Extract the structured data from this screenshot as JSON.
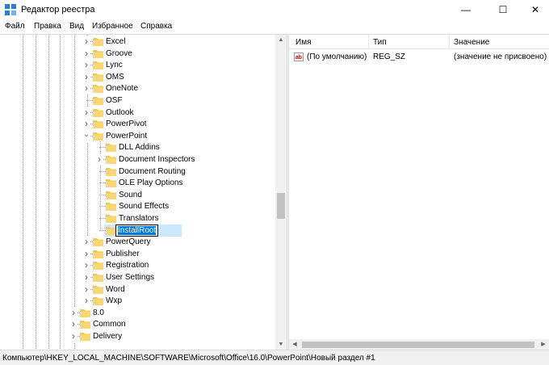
{
  "window": {
    "title": "Редактор реестра",
    "minimize_glyph": "—",
    "maximize_glyph": "☐",
    "close_glyph": "✕"
  },
  "menu": [
    "Файл",
    "Правка",
    "Вид",
    "Избранное",
    "Справка"
  ],
  "tree": {
    "items": [
      {
        "label": "Excel",
        "level": 2,
        "expander": "collapsed"
      },
      {
        "label": "Groove",
        "level": 2,
        "expander": "collapsed"
      },
      {
        "label": "Lync",
        "level": 2,
        "expander": "collapsed"
      },
      {
        "label": "OMS",
        "level": 2,
        "expander": "collapsed"
      },
      {
        "label": "OneNote",
        "level": 2,
        "expander": "collapsed"
      },
      {
        "label": "OSF",
        "level": 2,
        "expander": "none"
      },
      {
        "label": "Outlook",
        "level": 2,
        "expander": "collapsed"
      },
      {
        "label": "PowerPivot",
        "level": 2,
        "expander": "collapsed"
      },
      {
        "label": "PowerPoint",
        "level": 2,
        "expander": "expanded"
      },
      {
        "label": "DLL Addins",
        "level": 3,
        "expander": "none"
      },
      {
        "label": "Document Inspectors",
        "level": 3,
        "expander": "collapsed"
      },
      {
        "label": "Document Routing",
        "level": 3,
        "expander": "none"
      },
      {
        "label": "OLE Play Options",
        "level": 3,
        "expander": "none"
      },
      {
        "label": "Sound",
        "level": 3,
        "expander": "none"
      },
      {
        "label": "Sound Effects",
        "level": 3,
        "expander": "none"
      },
      {
        "label": "Translators",
        "level": 3,
        "expander": "none"
      },
      {
        "label": "InstallRoot",
        "level": 3,
        "expander": "none",
        "editing": true
      },
      {
        "label": "PowerQuery",
        "level": 2,
        "expander": "collapsed"
      },
      {
        "label": "Publisher",
        "level": 2,
        "expander": "collapsed"
      },
      {
        "label": "Registration",
        "level": 2,
        "expander": "collapsed"
      },
      {
        "label": "User Settings",
        "level": 2,
        "expander": "collapsed"
      },
      {
        "label": "Word",
        "level": 2,
        "expander": "collapsed"
      },
      {
        "label": "Wxp",
        "level": 2,
        "expander": "collapsed"
      },
      {
        "label": "8.0",
        "level": 1,
        "expander": "collapsed"
      },
      {
        "label": "Common",
        "level": 1,
        "expander": "collapsed"
      },
      {
        "label": "Delivery",
        "level": 1,
        "expander": "collapsed"
      }
    ]
  },
  "list": {
    "columns": [
      "Имя",
      "Тип",
      "Значение"
    ],
    "rows": [
      {
        "icon": "ab",
        "name": "(По умолчанию)",
        "type": "REG_SZ",
        "value": "(значение не присвоено)"
      }
    ]
  },
  "status": {
    "path": "Компьютер\\HKEY_LOCAL_MACHINE\\SOFTWARE\\Microsoft\\Office\\16.0\\PowerPoint\\Новый раздел #1"
  },
  "colors": {
    "folder": "#f5c84c",
    "selection": "#0078d7",
    "row_highlight": "#cce8ff",
    "icon_blue": "#2a7fd4"
  }
}
